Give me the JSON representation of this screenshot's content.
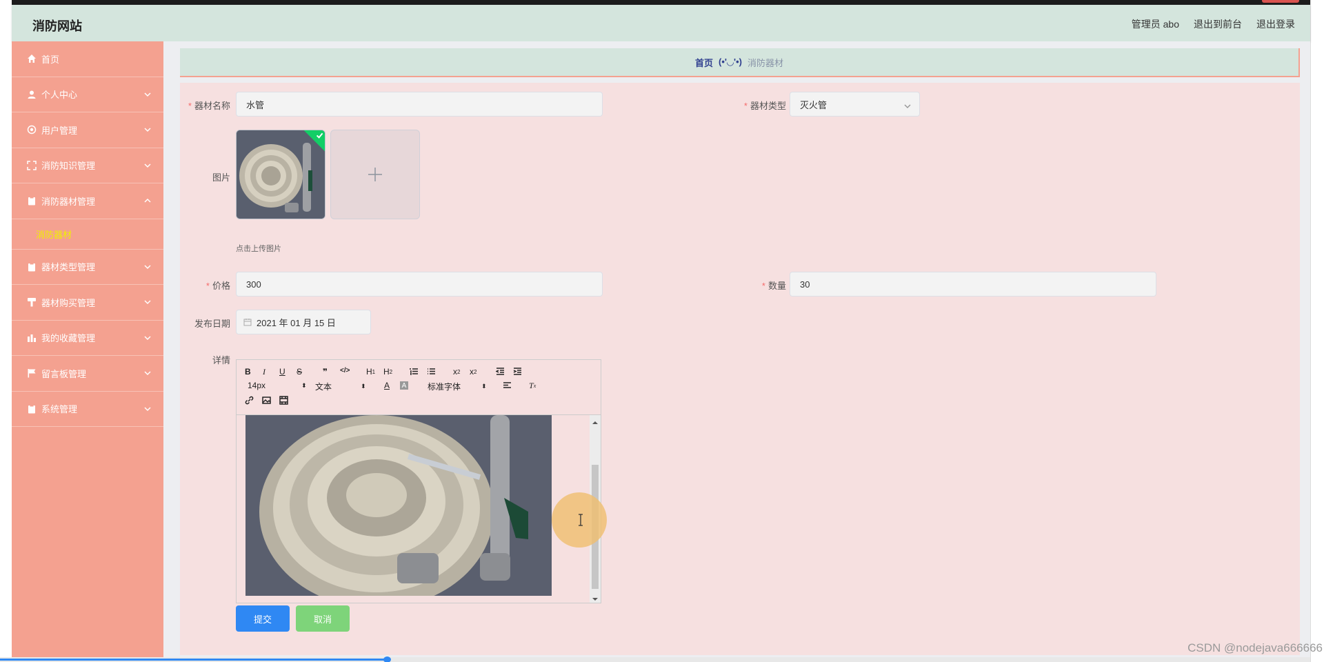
{
  "header": {
    "site_title": "消防网站",
    "admin_label": "管理员 abo",
    "to_frontend": "退出到前台",
    "logout": "退出登录"
  },
  "sidebar": {
    "items": [
      {
        "label": "首页",
        "icon": "home-icon"
      },
      {
        "label": "个人中心",
        "icon": "user-icon"
      },
      {
        "label": "用户管理",
        "icon": "settings-icon"
      },
      {
        "label": "消防知识管理",
        "icon": "fullscreen-icon"
      },
      {
        "label": "消防器材管理",
        "icon": "clipboard-icon",
        "expanded": true
      },
      {
        "label": "器材类型管理",
        "icon": "clipboard-icon"
      },
      {
        "label": "器材购买管理",
        "icon": "hammer-icon"
      },
      {
        "label": "我的收藏管理",
        "icon": "chart-icon"
      },
      {
        "label": "留言板管理",
        "icon": "flag-icon"
      },
      {
        "label": "系统管理",
        "icon": "clipboard-icon"
      }
    ],
    "submenu_active": "消防器材",
    "active_color": "#f0f000"
  },
  "breadcrumb": {
    "home": "首页",
    "separator": "(•'◡'•)",
    "current": "消防器材"
  },
  "form": {
    "name_label": "器材名称",
    "name_value": "水管",
    "type_label": "器材类型",
    "type_value": "灭火管",
    "image_label": "图片",
    "upload_hint": "点击上传图片",
    "price_label": "价格",
    "price_value": "300",
    "qty_label": "数量",
    "qty_value": "30",
    "date_label": "发布日期",
    "date_value": "2021 年 01 月 15 日",
    "detail_label": "详情"
  },
  "editor": {
    "size": "14px",
    "text_type": "文本",
    "font": "标准字体"
  },
  "buttons": {
    "submit": "提交",
    "cancel": "取消"
  },
  "watermark": "CSDN @nodejava666666",
  "colors": {
    "sidebar_bg": "#f4a190",
    "header_bg": "#d4e5dd",
    "panel_bg": "#f6e0e0",
    "primary": "#2f88f3",
    "success": "#7ed47a"
  }
}
